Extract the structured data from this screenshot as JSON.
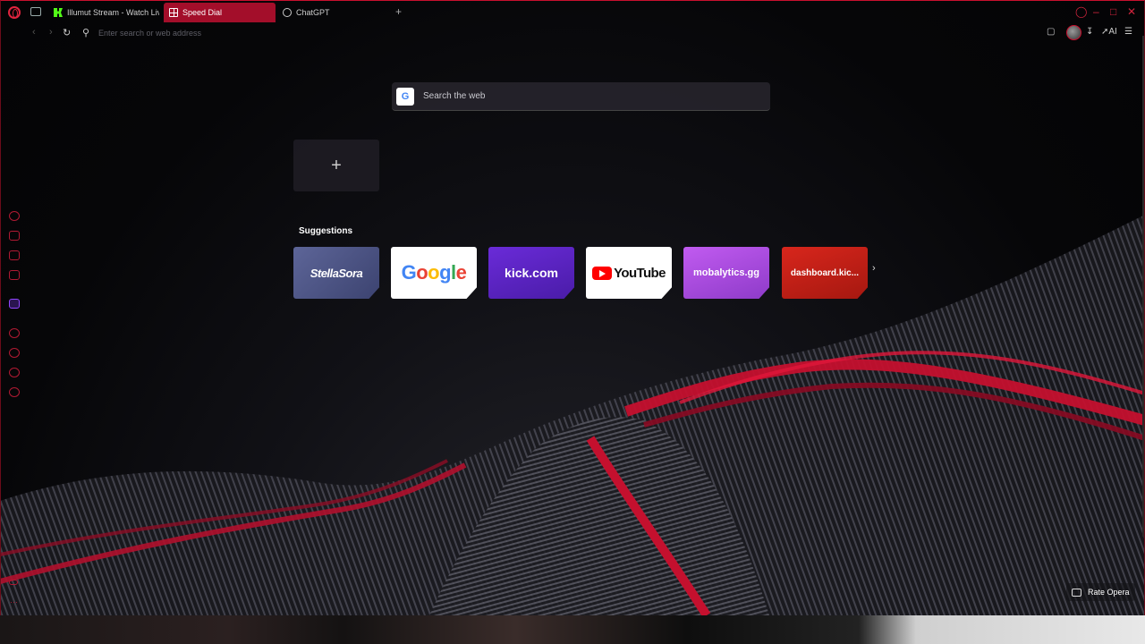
{
  "tabs": [
    {
      "label": "Illumut Stream - Watch Live",
      "icon": "kick-icon"
    },
    {
      "label": "Speed Dial",
      "icon": "speed-dial-icon",
      "active": true
    },
    {
      "label": "ChatGPT",
      "icon": "chatgpt-icon"
    }
  ],
  "address": {
    "placeholder": "Enter search or web address"
  },
  "toolbar": {
    "ai_label": "AI"
  },
  "search": {
    "placeholder": "Search the web",
    "engine": "G"
  },
  "speed_dial": {
    "add_symbol": "+",
    "suggestions_title": "Suggestions",
    "tiles": [
      {
        "label": "StellaSora"
      },
      {
        "label": "Google"
      },
      {
        "label": "kick.com"
      },
      {
        "label": "YouTube"
      },
      {
        "label": "mobalytics.gg"
      },
      {
        "label": "dashboard.kic..."
      }
    ],
    "next_symbol": "›"
  },
  "footer": {
    "rate_label": "Rate Opera"
  },
  "colors": {
    "accent": "#c8102e",
    "active_tab": "#a30e2a",
    "twitch": "#9146ff"
  }
}
